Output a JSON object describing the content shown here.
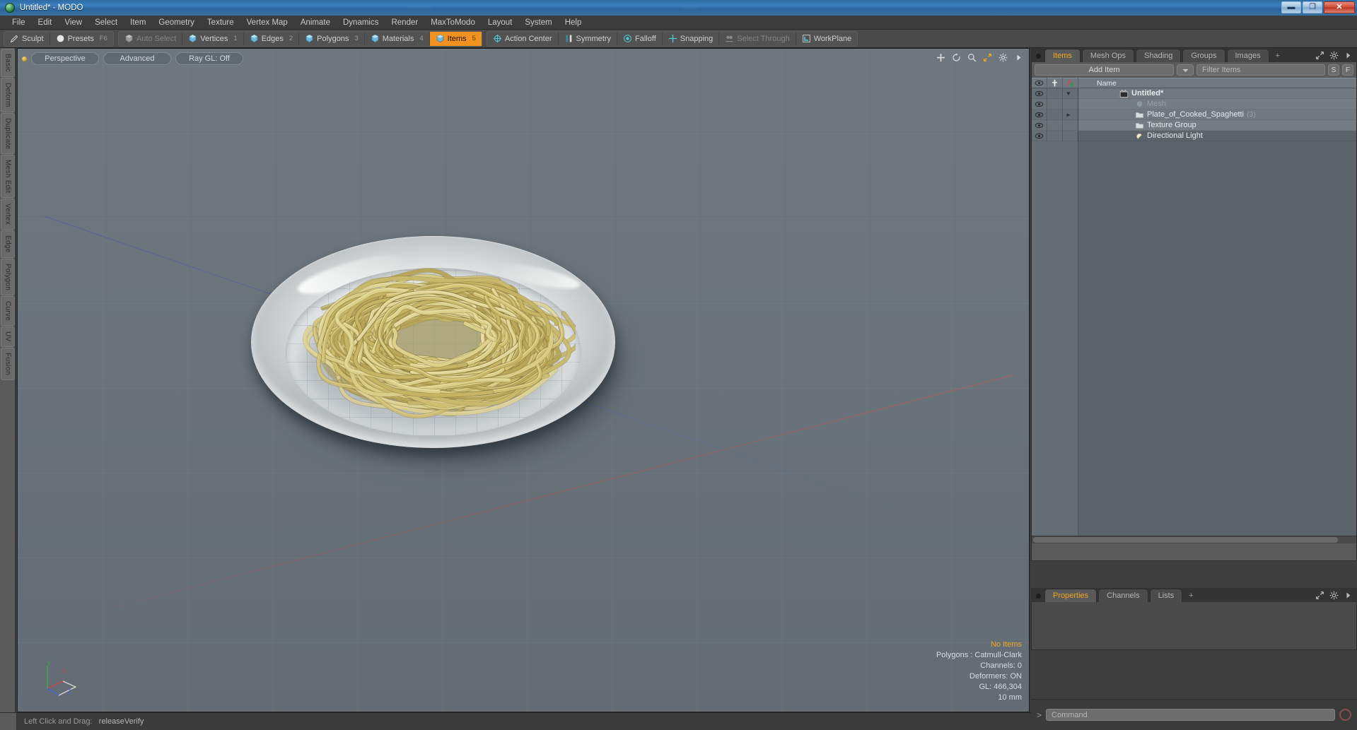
{
  "window": {
    "title": "Untitled* - MODO",
    "app_icon": "modo-app-icon",
    "minimize": "–",
    "maximize": "❐",
    "close": "✕"
  },
  "menubar": {
    "items": [
      "File",
      "Edit",
      "View",
      "Select",
      "Item",
      "Geometry",
      "Texture",
      "Vertex Map",
      "Animate",
      "Dynamics",
      "Render",
      "MaxToModo",
      "Layout",
      "System",
      "Help"
    ]
  },
  "toolbar": {
    "group1": [
      {
        "label": "Sculpt",
        "icon": "brush-icon",
        "state": "normal",
        "num": ""
      },
      {
        "label": "Presets",
        "icon": "sphere-icon",
        "state": "normal",
        "num": "F6"
      }
    ],
    "group2": [
      {
        "label": "Auto Select",
        "icon": "cube-grey-icon",
        "state": "dim",
        "num": ""
      },
      {
        "label": "Vertices",
        "icon": "cube-blue-icon",
        "state": "normal",
        "num": "1"
      },
      {
        "label": "Edges",
        "icon": "cube-blue-icon",
        "state": "normal",
        "num": "2"
      },
      {
        "label": "Polygons",
        "icon": "cube-blue-icon",
        "state": "normal",
        "num": "3"
      },
      {
        "label": "Materials",
        "icon": "cube-blue-icon",
        "state": "normal",
        "num": "4"
      },
      {
        "label": "Items",
        "icon": "cube-blue-icon",
        "state": "active",
        "num": "5"
      }
    ],
    "group3": [
      {
        "label": "Action Center",
        "icon": "crosshair-icon",
        "state": "normal",
        "num": ""
      },
      {
        "label": "Symmetry",
        "icon": "symmetry-icon",
        "state": "normal",
        "num": ""
      },
      {
        "label": "Falloff",
        "icon": "falloff-icon",
        "state": "normal",
        "num": ""
      },
      {
        "label": "Snapping",
        "icon": "snap-icon",
        "state": "normal",
        "num": ""
      },
      {
        "label": "Select Through",
        "icon": "select-through-icon",
        "state": "dim",
        "num": ""
      },
      {
        "label": "WorkPlane",
        "icon": "workplane-icon",
        "state": "normal",
        "num": ""
      }
    ]
  },
  "left_tabs": [
    "Basic",
    "Deform",
    "Duplicate",
    "Mesh Edit",
    "Vertex",
    "Edge",
    "Polygon",
    "Curve",
    "UV",
    "Fusion"
  ],
  "viewport": {
    "mode_pills": [
      "Perspective",
      "Advanced",
      "Ray GL: Off"
    ],
    "nav_icons": [
      "move-icon",
      "rotate-icon",
      "zoom-icon",
      "fit-icon",
      "gear-icon",
      "chevron-right-icon"
    ],
    "hud": {
      "selection": "No Items",
      "polygons": "Polygons : Catmull-Clark",
      "channels": "Channels: 0",
      "deformers": "Deformers: ON",
      "gl": "GL: 466,304",
      "scale": "10 mm"
    },
    "gizmo": {
      "x_label": "X",
      "y_label": "Y",
      "z_label": "Z"
    }
  },
  "items_panel": {
    "tabs": [
      {
        "label": "Items",
        "active": true
      },
      {
        "label": "Mesh Ops",
        "active": false
      },
      {
        "label": "Shading",
        "active": false
      },
      {
        "label": "Groups",
        "active": false
      },
      {
        "label": "Images",
        "active": false
      }
    ],
    "add_tab": "+",
    "add_item_label": "Add Item",
    "filter_placeholder": "Filter Items",
    "filter_value": "",
    "btn_s": "S",
    "btn_f": "F",
    "columns": [
      "",
      "",
      "",
      "Name"
    ],
    "column_name_header": "Name",
    "rows": [
      {
        "name": "Untitled*",
        "icon": "scene-icon",
        "level": 0,
        "dim": false,
        "count": "",
        "expander": "down"
      },
      {
        "name": "Mesh",
        "icon": "mesh-icon",
        "level": 1,
        "dim": true,
        "count": "",
        "expander": "none"
      },
      {
        "name": "Plate_of_Cooked_Spaghetti",
        "icon": "group-icon",
        "level": 1,
        "dim": false,
        "count": "(3)",
        "expander": "right"
      },
      {
        "name": "Texture Group",
        "icon": "group-icon",
        "level": 1,
        "dim": false,
        "count": "",
        "expander": "none"
      },
      {
        "name": "Directional Light",
        "icon": "light-icon",
        "level": 1,
        "dim": false,
        "count": "",
        "expander": "none"
      }
    ]
  },
  "properties_panel": {
    "tabs": [
      {
        "label": "Properties",
        "active": true
      },
      {
        "label": "Channels",
        "active": false
      },
      {
        "label": "Lists",
        "active": false
      }
    ],
    "add_tab": "+"
  },
  "command_bar": {
    "prompt": ">",
    "placeholder": "Command",
    "value": "",
    "record_icon": "record-icon"
  },
  "statusbar": {
    "action": "Left Click and Drag:",
    "value": "releaseVerify"
  },
  "colors": {
    "accent_orange": "#f0a81e",
    "panel_bg": "#5a5a5a",
    "viewport_bg": "#6a7379",
    "noodle": "#d9ca7a",
    "plate": "#e9ebec"
  }
}
